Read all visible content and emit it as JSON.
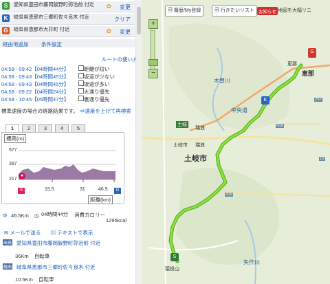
{
  "waypoints": [
    {
      "badge": "S",
      "color": "#3d9a3d",
      "text": "愛知県豊田市藤岡飯野町弥治前 付近",
      "action": "変更"
    },
    {
      "badge": "K",
      "color": "#2c66c4",
      "text": "岐阜県恵那市三郷町佐々良木 付近",
      "action": "クリア"
    },
    {
      "badge": "G",
      "color": "#e05a26",
      "text": "岐阜県恵那市大井町 付近",
      "action": "変更"
    }
  ],
  "links": {
    "add": "経由地追加",
    "conditions": "条件設定",
    "route_usage": "ルートの使い方"
  },
  "routes": [
    {
      "time": "04:58 - 09:42【04時間44分】",
      "option": "距離が短い"
    },
    {
      "time": "04:58 - 09:43【04時間45分】",
      "option": "坂道が少ない"
    },
    {
      "time": "04:58 - 09:43【04時間45分】",
      "option": "坂道が多い"
    },
    {
      "time": "04:58 - 09:22【04時間24分】",
      "option": "大通り優先"
    },
    {
      "time": "04:58 - 10:45【05時間47分】",
      "option": "裏通り優先"
    }
  ],
  "speed_note": "標準速度の場合の経路結果です。",
  "speed_link": "⇒速度を上げて再検索",
  "tabs": [
    "1",
    "2",
    "3",
    "4",
    "5"
  ],
  "elevation": {
    "title": "標高(m)",
    "y_labels": [
      "577",
      "397",
      "217"
    ],
    "x_labels": [
      "15.5",
      "31",
      "46.5"
    ],
    "x_axis": "距離(km)"
  },
  "summary": {
    "distance": "46.5Km",
    "time": "04時間44分",
    "calorie_label": "消費カロリー",
    "calorie": "1295kcal"
  },
  "share": {
    "mail": "メールで送る",
    "text": "テキストで表示"
  },
  "directions": [
    {
      "badge": "出発",
      "place": "愛知県豊田市藤岡飯野町弥治前 付近",
      "dist": "36Km",
      "mode": "自転車"
    },
    {
      "badge": "経由",
      "place": "岐阜県恵那市三郷町佐々良木 付近",
      "dist": "10.5Km",
      "mode": "自転車"
    }
  ],
  "map_buttons": {
    "history": "履歴/My登録",
    "wishlist": "行きたいリスト",
    "news": "お知らせ",
    "notice": "地図を大幅リニ"
  },
  "map_labels": [
    "恵那",
    "恵那",
    "中央道",
    "土岐市",
    "土岐",
    "瑞浪",
    "瑞浪",
    "木曽川",
    "土岐市",
    "矢作川",
    "猿投山"
  ],
  "road_numbers": [
    "257",
    "418",
    "419",
    "19"
  ],
  "colors": {
    "route": "#7ddc2e",
    "routeEdge": "#4fa818",
    "map": "#e9efdf",
    "link": "#1d5fb8"
  }
}
